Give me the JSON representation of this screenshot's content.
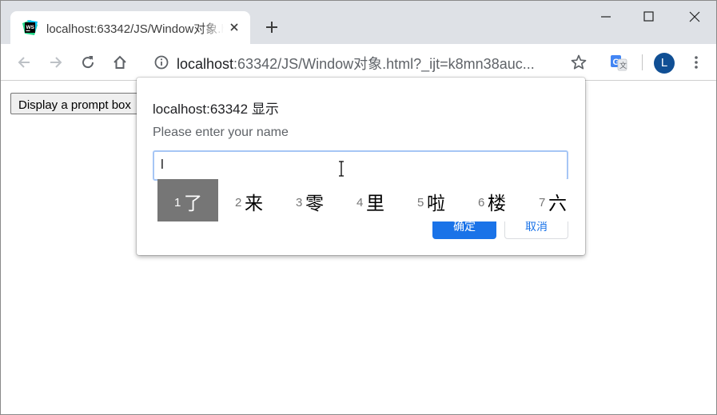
{
  "tab": {
    "title": "localhost:63342/JS/Window对象.html",
    "favicon": "webstorm-icon"
  },
  "window_controls": {
    "minimize": "minimize-icon",
    "maximize": "maximize-icon",
    "close": "close-icon"
  },
  "toolbar": {
    "url_host": "localhost",
    "url_rest": ":63342/JS/Window对象.html?_ijt=k8mn38auc...",
    "avatar_letter": "L"
  },
  "page": {
    "button_label": "Display a prompt box"
  },
  "dialog": {
    "title": "localhost:63342 显示",
    "message": "Please enter your name",
    "input_value": "l",
    "ok_label": "确定",
    "cancel_label": "取消"
  },
  "ime": {
    "candidates": [
      {
        "num": "1",
        "char": "了"
      },
      {
        "num": "2",
        "char": "来"
      },
      {
        "num": "3",
        "char": "零"
      },
      {
        "num": "4",
        "char": "里"
      },
      {
        "num": "5",
        "char": "啦"
      },
      {
        "num": "6",
        "char": "楼"
      },
      {
        "num": "7",
        "char": "六"
      }
    ]
  },
  "colors": {
    "accent": "#1a73e8",
    "tabstrip": "#dee1e6",
    "avatar": "#104f94",
    "ime_selected": "#767676"
  }
}
